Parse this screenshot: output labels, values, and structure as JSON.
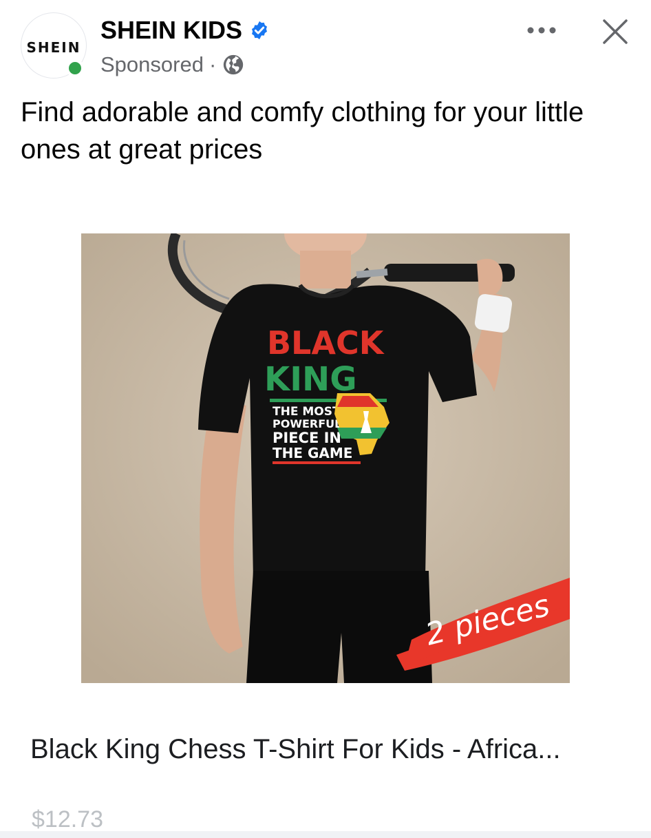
{
  "advertiser": {
    "avatar_text": "SHEIN",
    "name": "SHEIN KIDS",
    "sponsored_label": "Sponsored",
    "separator": "·",
    "verified_icon": "verified-badge-icon",
    "audience_icon": "globe-icon",
    "online_status_color": "#31a24c",
    "verified_color": "#1877f2"
  },
  "actions": {
    "more_icon": "more-options-icon",
    "close_icon": "close-icon"
  },
  "caption": "Find adorable and comfy clothing for your little ones at great prices",
  "image": {
    "shirt_text": {
      "line1": "BLACK",
      "line2": "KING",
      "line3": "THE MOST",
      "line4": "POWERFUL",
      "line5": "PIECE IN",
      "line6": "THE GAME"
    },
    "badge_text": "2 pieces",
    "colors": {
      "background": "#c9bba9",
      "shirt": "#111111",
      "red": "#e0352b",
      "green": "#2e9e58",
      "yellow": "#f2c230",
      "badge": "#e8372a"
    }
  },
  "product": {
    "title": "Black King Chess T-Shirt For Kids - Africa...",
    "price": "$12.73"
  }
}
